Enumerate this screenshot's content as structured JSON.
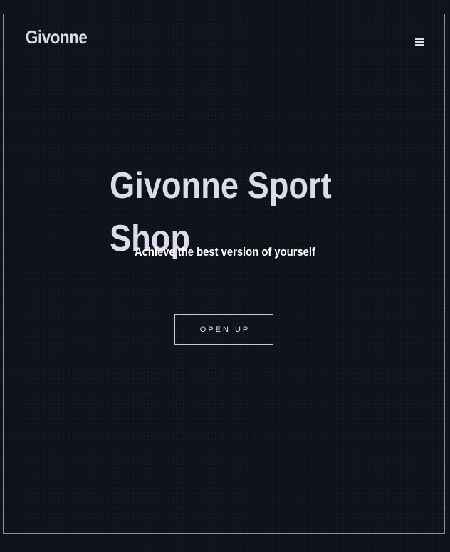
{
  "header": {
    "logo_text": "Givonne",
    "menu_icon": "hamburger-menu-icon"
  },
  "hero": {
    "title": "Givonne Sport Shop",
    "subtitle": "Achieve the best version of yourself",
    "cta_label": "OPEN UP"
  },
  "colors": {
    "background": "#0f121b",
    "text": "#dcdce8",
    "border": "#8a8e99"
  }
}
